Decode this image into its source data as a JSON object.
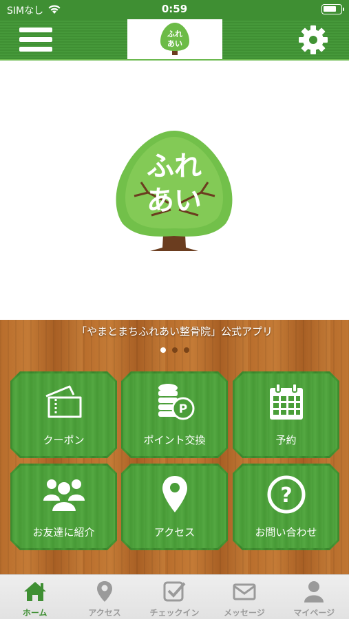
{
  "status_bar": {
    "carrier": "SIMなし",
    "time": "0:59",
    "battery_level": 0.8,
    "icons": [
      "wifi-icon",
      "battery-icon"
    ]
  },
  "header": {
    "logo_text_line1": "ふれ",
    "logo_text_line2": "あい",
    "icons": [
      "menu-icon",
      "settings-icon"
    ]
  },
  "hero": {
    "logo_text_line1": "ふれ",
    "logo_text_line2": "あい"
  },
  "banner": {
    "title": "「やまとまちふれあい整骨院」公式アプリ",
    "page_count": 3,
    "active_page": 1
  },
  "menu": {
    "tiles": [
      {
        "label": "クーポン",
        "icon": "coupon-icon"
      },
      {
        "label": "ポイント交換",
        "icon": "point-exchange-icon"
      },
      {
        "label": "予約",
        "icon": "calendar-icon"
      },
      {
        "label": "お友達に紹介",
        "icon": "friends-icon"
      },
      {
        "label": "アクセス",
        "icon": "map-pin-icon"
      },
      {
        "label": "お問い合わせ",
        "icon": "question-icon"
      }
    ]
  },
  "tab_bar": {
    "tabs": [
      {
        "label": "ホーム",
        "icon": "home-icon",
        "active": true
      },
      {
        "label": "アクセス",
        "icon": "map-pin-icon",
        "active": false
      },
      {
        "label": "チェックイン",
        "icon": "checkin-icon",
        "active": false
      },
      {
        "label": "メッセージ",
        "icon": "mail-icon",
        "active": false
      },
      {
        "label": "マイページ",
        "icon": "user-icon",
        "active": false
      }
    ]
  },
  "colors": {
    "primary_green": "#3f8f33",
    "wood": "#b86d2c",
    "tab_inactive": "#9a9a9a"
  }
}
